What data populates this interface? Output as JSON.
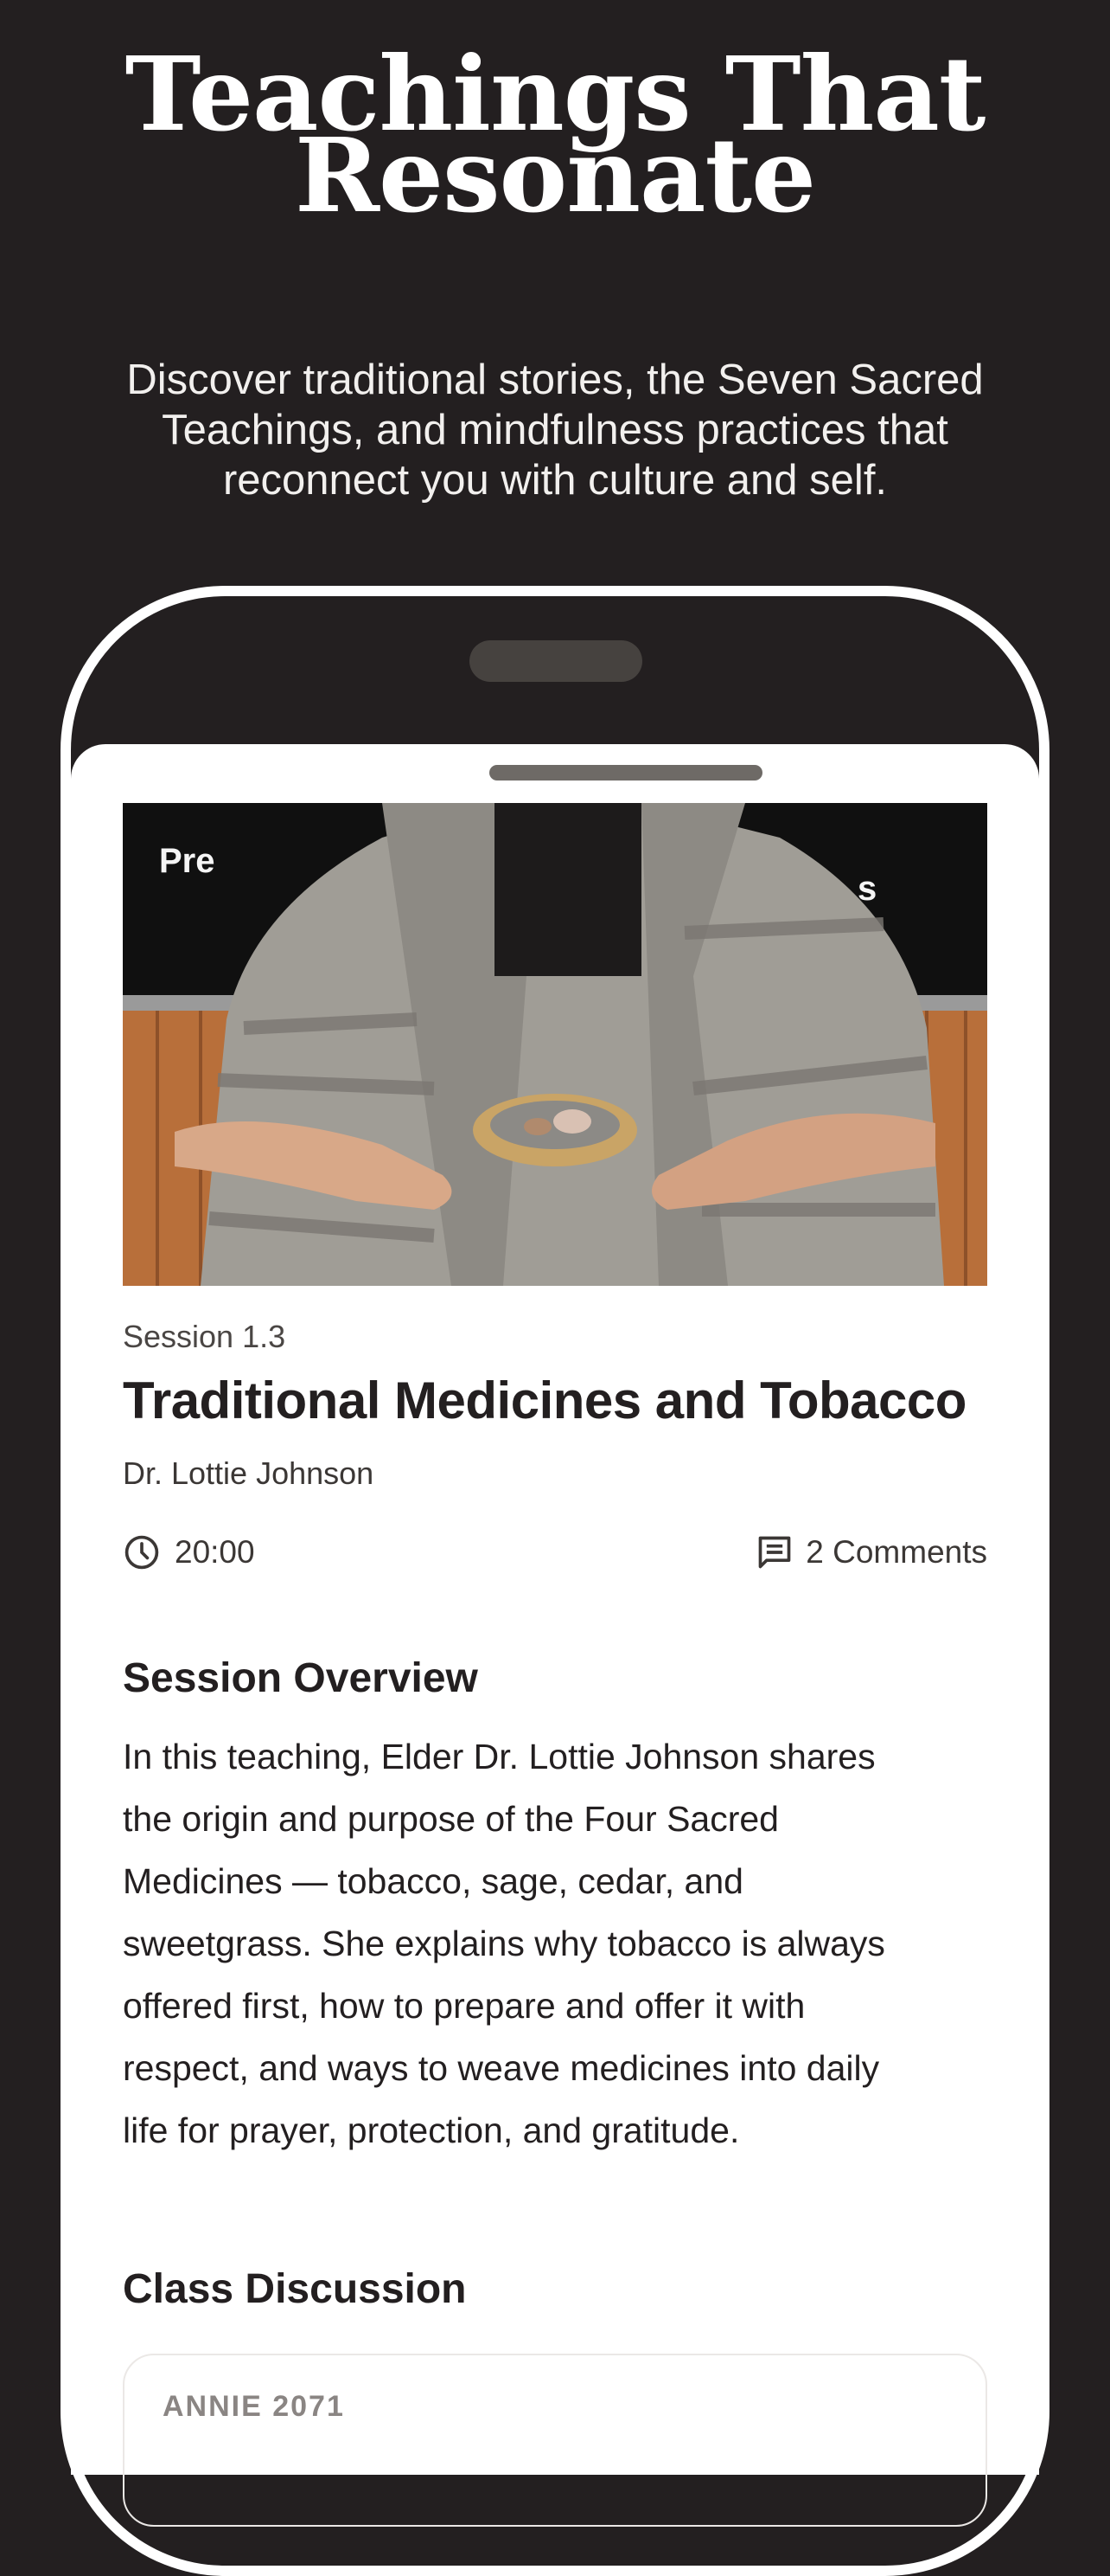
{
  "hero": {
    "title_line1": "Teachings That",
    "title_line2": "Resonate",
    "subtitle_line1": "Discover traditional stories, the Seven Sacred",
    "subtitle_line2": "Teachings, and mindfulness practices that",
    "subtitle_line3": "reconnect you with culture and self."
  },
  "session": {
    "label": "Session 1.3",
    "title": "Traditional Medicines and Tobacco",
    "instructor": "Dr. Lottie Johnson",
    "duration": "20:00",
    "comments": "2 Comments",
    "media_sign_left": "Pre",
    "media_sign_right": "s"
  },
  "overview": {
    "heading": "Session Overview",
    "lines": [
      "In this teaching, Elder Dr. Lottie Johnson shares",
      "the origin and purpose of the Four Sacred",
      "Medicines — tobacco, sage, cedar, and",
      "sweetgrass. She explains why tobacco is always",
      "offered first, how to prepare and offer it with",
      "respect, and ways to weave medicines into daily",
      "life for prayer, protection, and gratitude."
    ]
  },
  "discussion": {
    "heading": "Class Discussion",
    "first_comment_author": "ANNIE 2071"
  },
  "icons": {
    "duration": "clock-icon",
    "comments": "comment-icon"
  },
  "colors": {
    "background": "#231f20",
    "sheet": "#ffffff",
    "text_primary": "#231f20",
    "text_secondary": "#3b3735"
  }
}
